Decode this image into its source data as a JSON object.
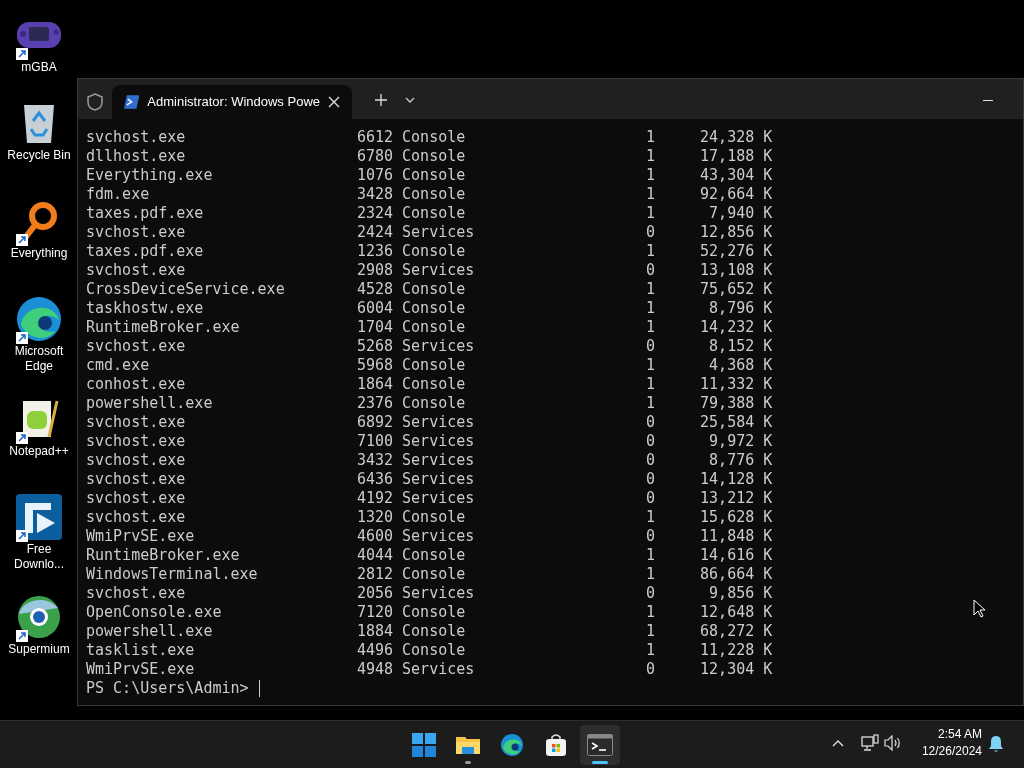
{
  "desktop_icons": [
    {
      "kind": "gba",
      "label": "mGBA",
      "shortcut": true
    },
    {
      "kind": "recycle",
      "label": "Recycle Bin",
      "shortcut": false
    },
    {
      "kind": "everything",
      "label": "Everything",
      "shortcut": true
    },
    {
      "kind": "edge",
      "label": "Microsoft Edge",
      "shortcut": true
    },
    {
      "kind": "notepad",
      "label": "Notepad++",
      "shortcut": true
    },
    {
      "kind": "fdm",
      "label": "Free Downlo...",
      "shortcut": true
    },
    {
      "kind": "supermium",
      "label": "Supermium",
      "shortcut": true
    }
  ],
  "terminal": {
    "tab_title": "Administrator: Windows Powe",
    "rows": [
      [
        "svchost.exe",
        "6612",
        "Console",
        "1",
        "24,328 K"
      ],
      [
        "dllhost.exe",
        "6780",
        "Console",
        "1",
        "17,188 K"
      ],
      [
        "Everything.exe",
        "1076",
        "Console",
        "1",
        "43,304 K"
      ],
      [
        "fdm.exe",
        "3428",
        "Console",
        "1",
        "92,664 K"
      ],
      [
        "taxes.pdf.exe",
        "2324",
        "Console",
        "1",
        "7,940 K"
      ],
      [
        "svchost.exe",
        "2424",
        "Services",
        "0",
        "12,856 K"
      ],
      [
        "taxes.pdf.exe",
        "1236",
        "Console",
        "1",
        "52,276 K"
      ],
      [
        "svchost.exe",
        "2908",
        "Services",
        "0",
        "13,108 K"
      ],
      [
        "CrossDeviceService.exe",
        "4528",
        "Console",
        "1",
        "75,652 K"
      ],
      [
        "taskhostw.exe",
        "6004",
        "Console",
        "1",
        "8,796 K"
      ],
      [
        "RuntimeBroker.exe",
        "1704",
        "Console",
        "1",
        "14,232 K"
      ],
      [
        "svchost.exe",
        "5268",
        "Services",
        "0",
        "8,152 K"
      ],
      [
        "cmd.exe",
        "5968",
        "Console",
        "1",
        "4,368 K"
      ],
      [
        "conhost.exe",
        "1864",
        "Console",
        "1",
        "11,332 K"
      ],
      [
        "powershell.exe",
        "2376",
        "Console",
        "1",
        "79,388 K"
      ],
      [
        "svchost.exe",
        "6892",
        "Services",
        "0",
        "25,584 K"
      ],
      [
        "svchost.exe",
        "7100",
        "Services",
        "0",
        "9,972 K"
      ],
      [
        "svchost.exe",
        "3432",
        "Services",
        "0",
        "8,776 K"
      ],
      [
        "svchost.exe",
        "6436",
        "Services",
        "0",
        "14,128 K"
      ],
      [
        "svchost.exe",
        "4192",
        "Services",
        "0",
        "13,212 K"
      ],
      [
        "svchost.exe",
        "1320",
        "Console",
        "1",
        "15,628 K"
      ],
      [
        "WmiPrvSE.exe",
        "4600",
        "Services",
        "0",
        "11,848 K"
      ],
      [
        "RuntimeBroker.exe",
        "4044",
        "Console",
        "1",
        "14,616 K"
      ],
      [
        "WindowsTerminal.exe",
        "2812",
        "Console",
        "1",
        "86,664 K"
      ],
      [
        "svchost.exe",
        "2056",
        "Services",
        "0",
        "9,856 K"
      ],
      [
        "OpenConsole.exe",
        "7120",
        "Console",
        "1",
        "12,648 K"
      ],
      [
        "powershell.exe",
        "1884",
        "Console",
        "1",
        "68,272 K"
      ],
      [
        "tasklist.exe",
        "4496",
        "Console",
        "1",
        "11,228 K"
      ],
      [
        "WmiPrvSE.exe",
        "4948",
        "Services",
        "0",
        "12,304 K"
      ]
    ],
    "prompt": "PS C:\\Users\\Admin>"
  },
  "taskbar": {
    "apps": [
      {
        "kind": "start",
        "running": false,
        "selected": false
      },
      {
        "kind": "explorer",
        "running": true,
        "selected": false
      },
      {
        "kind": "edge",
        "running": false,
        "selected": false
      },
      {
        "kind": "store",
        "running": false,
        "selected": false
      },
      {
        "kind": "terminal",
        "running": true,
        "selected": true
      }
    ],
    "time": "2:54 AM",
    "date": "12/26/2024"
  }
}
